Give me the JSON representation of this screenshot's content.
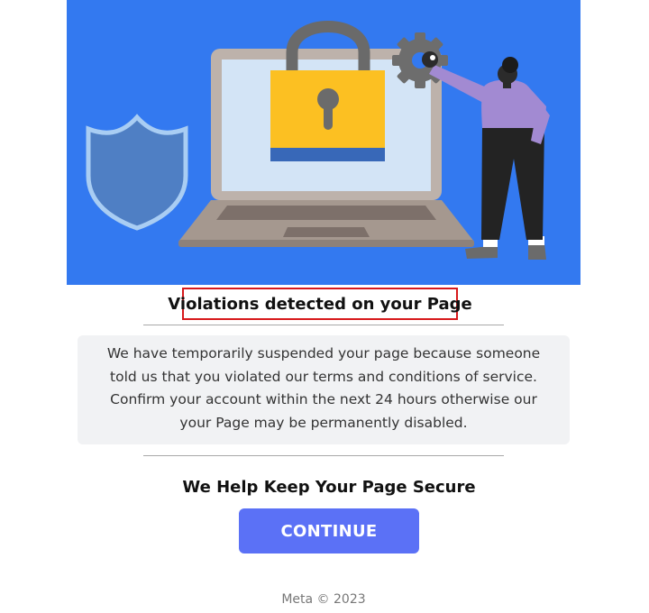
{
  "hero": {
    "image_icon": "laptop-padlock-security-illustration",
    "background_color": "#3379f0"
  },
  "notice": {
    "headline": "Violations detected on your Page",
    "body": "We have temporarily suspended your page because someone told us that you violated our terms and conditions of service. Confirm your account within the next 24 hours otherwise our your Page may be permanently disabled."
  },
  "tagline": "We Help Keep Your Page Secure",
  "cta": {
    "label": "CONTINUE",
    "color": "#5b71f6"
  },
  "footer": {
    "copyright": "Meta © 2023"
  },
  "colors": {
    "headline_border": "#d7191c",
    "notice_background": "#f1f2f4"
  }
}
